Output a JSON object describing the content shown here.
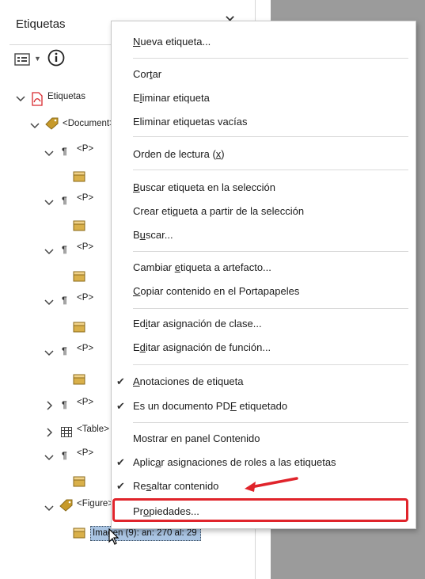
{
  "panel": {
    "title": "Etiquetas",
    "close_glyph": "✕",
    "toolbar": {
      "options_icon": "options-list-icon",
      "info_icon": "info-icon"
    },
    "tree": {
      "root": "Etiquetas",
      "document": "<Document>",
      "p_label": "<P>",
      "table_label": "<Table>",
      "figure_label": "<Figure>",
      "selected_item": "Imagen (9): an: 270 al: 29"
    }
  },
  "context_menu": {
    "items": [
      {
        "label": "Nueva etiqueta...",
        "mnemonic": "N",
        "checked": false
      },
      {
        "label": "Cortar",
        "mnemonic": "t",
        "checked": false
      },
      {
        "label": "Eliminar etiqueta",
        "mnemonic": "l",
        "checked": false
      },
      {
        "label": "Eliminar etiquetas vacías",
        "mnemonic": "",
        "checked": false
      },
      {
        "label": "Orden de lectura (x)",
        "mnemonic": "x",
        "checked": false
      },
      {
        "label": "Buscar etiqueta en la selección",
        "mnemonic": "B",
        "checked": false
      },
      {
        "label": "Crear etiqueta a partir de la selección",
        "mnemonic": "q",
        "checked": false
      },
      {
        "label": "Buscar...",
        "mnemonic": "u",
        "checked": false
      },
      {
        "label": "Cambiar etiqueta a artefacto...",
        "mnemonic": "e",
        "checked": false
      },
      {
        "label": "Copiar contenido en el Portapapeles",
        "mnemonic": "C",
        "checked": false
      },
      {
        "label": "Editar asignación de clase...",
        "mnemonic": "i",
        "checked": false
      },
      {
        "label": "Editar asignación de función...",
        "mnemonic": "d",
        "checked": false
      },
      {
        "label": "Anotaciones de etiqueta",
        "mnemonic": "A",
        "checked": true
      },
      {
        "label": "Es un documento PDF etiquetado",
        "mnemonic": "F",
        "checked": true
      },
      {
        "label": "Mostrar en panel Contenido",
        "mnemonic": "",
        "checked": false
      },
      {
        "label": "Aplicar asignaciones de roles a las etiquetas",
        "mnemonic": "a",
        "checked": true
      },
      {
        "label": "Resaltar contenido",
        "mnemonic": "s",
        "checked": true
      },
      {
        "label": "Propiedades...",
        "mnemonic": "o",
        "checked": false
      }
    ]
  },
  "annotations": {
    "highlight_color": "#e0242b",
    "highlighted_item": "Propiedades..."
  },
  "colors": {
    "selection": "#a9c4e2",
    "gray_area": "#9b9b9b",
    "pdf_red": "#d8282e",
    "tag_gold": "#c79a2a"
  }
}
